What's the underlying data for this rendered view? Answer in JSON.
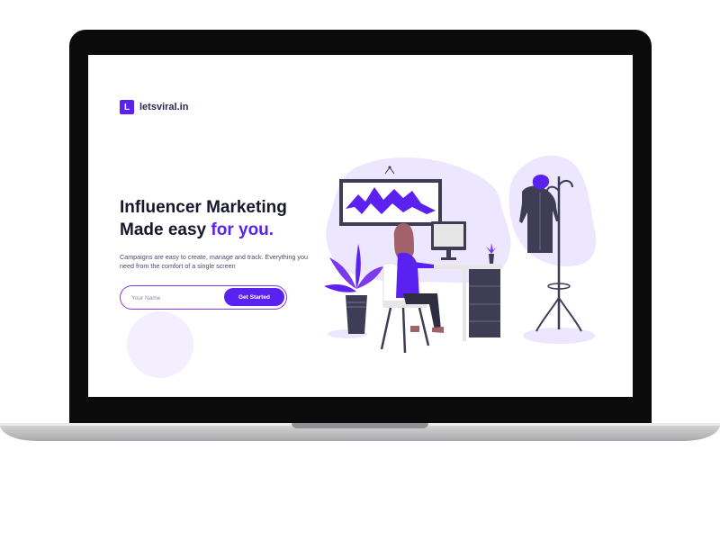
{
  "brand": {
    "logo_letter": "L",
    "name": "letsviral.in"
  },
  "hero": {
    "title_line1": "Influencer Marketing",
    "title_line2_prefix": "Made easy ",
    "title_line2_accent": "for you.",
    "description": "Campaigns are easy to create, manage and track. Everything you need from the comfort of a single screen"
  },
  "signup": {
    "name_placeholder": "Your Name",
    "button_label": "Get Started"
  },
  "colors": {
    "accent": "#5b21f0",
    "light_accent": "#ece6ff",
    "dark_text": "#17172b"
  },
  "illustration": {
    "name": "woman-working-at-desk-illustration"
  }
}
